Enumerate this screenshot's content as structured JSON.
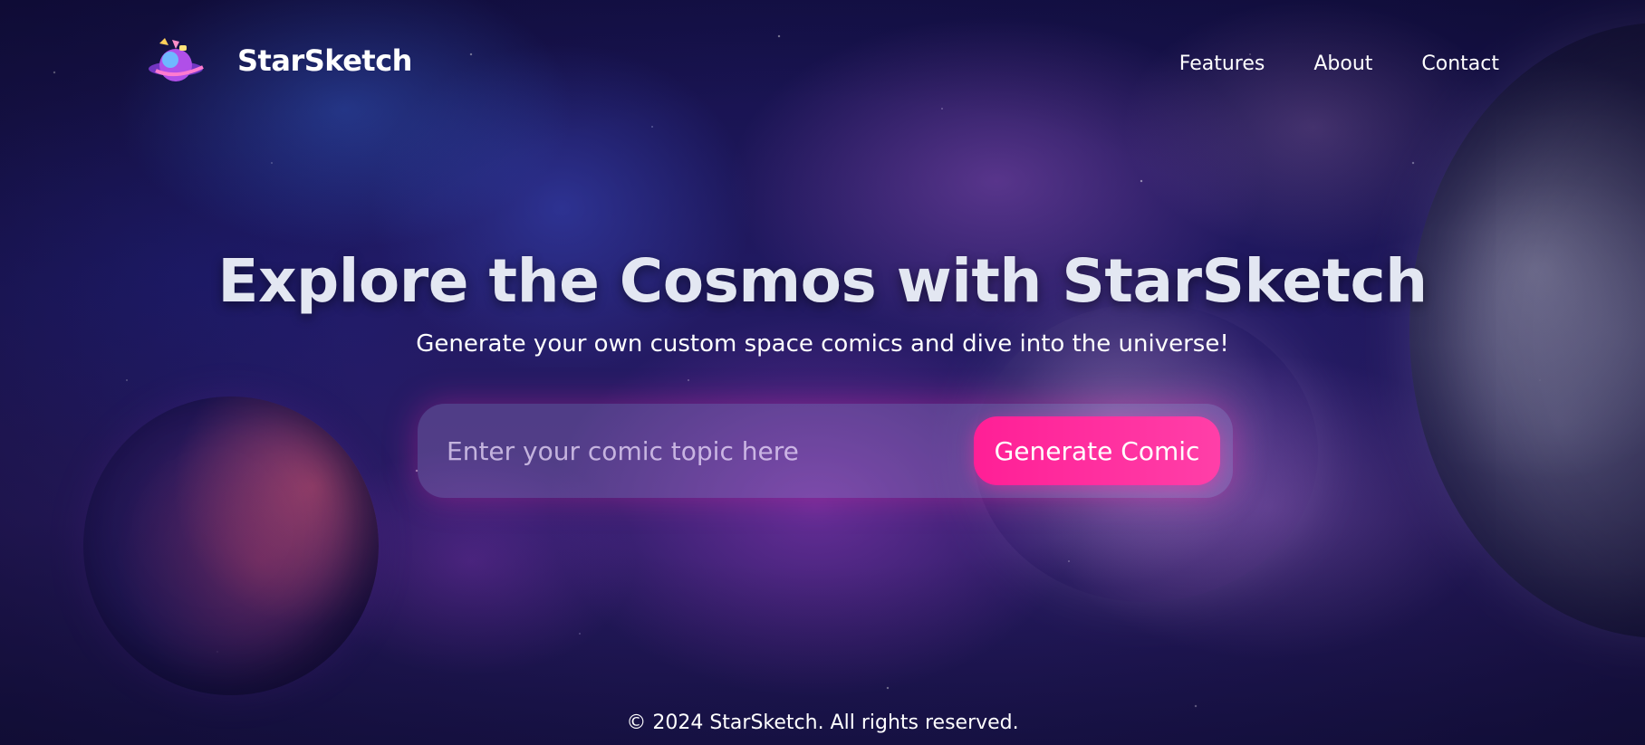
{
  "header": {
    "brand_name": "StarSketch",
    "logo_icon": "planet-logo-icon",
    "nav_items": [
      {
        "label": "Features"
      },
      {
        "label": "About"
      },
      {
        "label": "Contact"
      }
    ]
  },
  "hero": {
    "title": "Explore the Cosmos with StarSketch",
    "subtitle": "Generate your own custom space comics and dive into the universe!",
    "input_placeholder": "Enter your comic topic here",
    "input_value": "",
    "button_label": "Generate Comic"
  },
  "footer": {
    "text": "© 2024 StarSketch. All rights reserved."
  },
  "colors": {
    "accent": "#ff1f96",
    "text": "#ffffff",
    "title": "#e3e7f2",
    "background": "#1b1550"
  }
}
